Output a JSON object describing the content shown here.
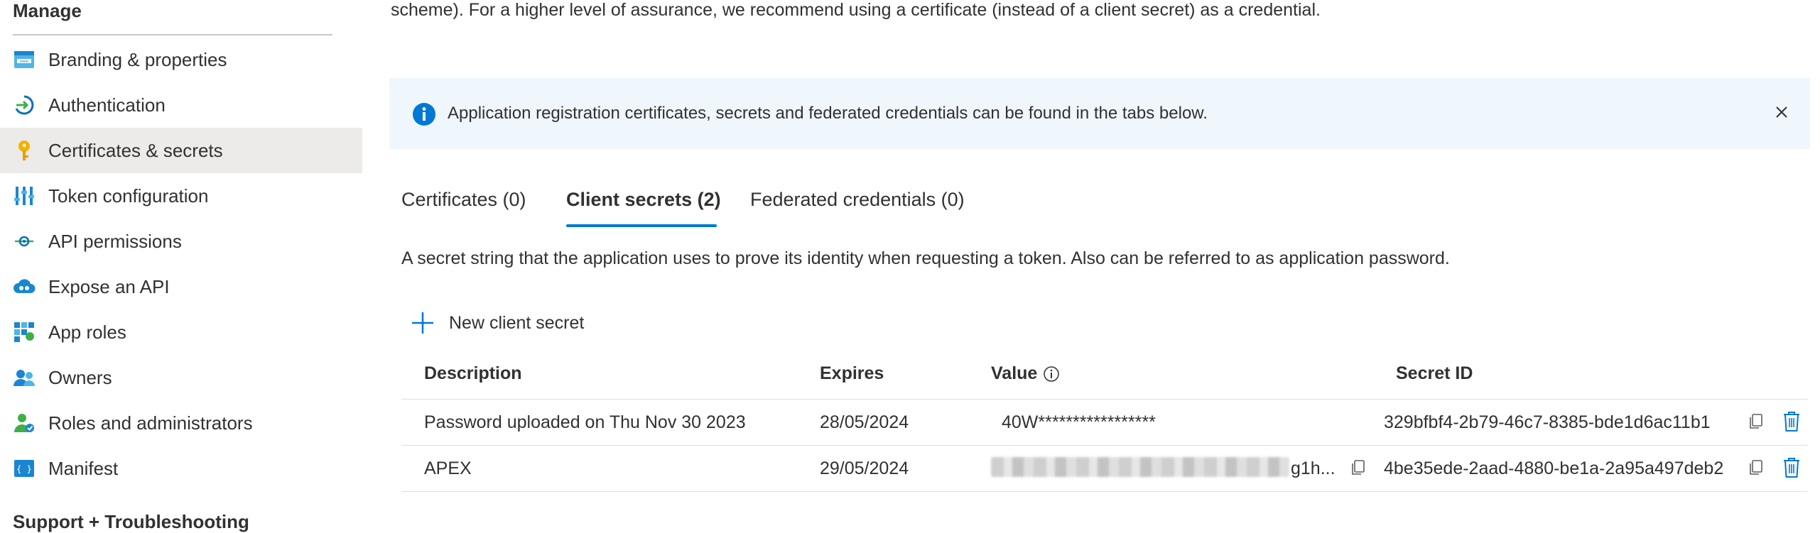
{
  "sidebar": {
    "section_title": "Manage",
    "items": [
      {
        "label": "Branding & properties",
        "icon": "branding-icon"
      },
      {
        "label": "Authentication",
        "icon": "authentication-icon"
      },
      {
        "label": "Certificates & secrets",
        "icon": "key-icon",
        "active": true
      },
      {
        "label": "Token configuration",
        "icon": "token-config-icon"
      },
      {
        "label": "API permissions",
        "icon": "api-permissions-icon"
      },
      {
        "label": "Expose an API",
        "icon": "cloud-icon"
      },
      {
        "label": "App roles",
        "icon": "app-roles-icon"
      },
      {
        "label": "Owners",
        "icon": "owners-icon"
      },
      {
        "label": "Roles and administrators",
        "icon": "roles-admin-icon"
      },
      {
        "label": "Manifest",
        "icon": "manifest-icon"
      }
    ],
    "support_title": "Support + Troubleshooting"
  },
  "main": {
    "intro": "scheme). For a higher level of assurance, we recommend using a certificate (instead of a client secret) as a credential.",
    "info_bar": {
      "text": "Application registration certificates, secrets and federated credentials can be found in the tabs below."
    },
    "tabs": [
      {
        "label": "Certificates (0)"
      },
      {
        "label": "Client secrets (2)",
        "active": true
      },
      {
        "label": "Federated credentials (0)"
      }
    ],
    "description": "A secret string that the application uses to prove its identity when requesting a token. Also can be referred to as application password.",
    "new_secret_label": "New client secret",
    "table": {
      "headers": {
        "description": "Description",
        "expires": "Expires",
        "value": "Value",
        "secret_id": "Secret ID"
      },
      "rows": [
        {
          "description": "Password uploaded on Thu Nov 30 2023",
          "expires": "28/05/2024",
          "value": "40W*****************",
          "secret_id": "329bfbf4-2b79-46c7-8385-bde1d6ac11b1"
        },
        {
          "description": "APEX",
          "expires": "29/05/2024",
          "value": "g1h...",
          "secret_id": "4be35ede-2aad-4880-be1a-2a95a497deb2"
        }
      ]
    }
  },
  "colors": {
    "accent": "#0078d4",
    "info_bg": "#eff6fc",
    "active_nav_bg": "#edebe9"
  }
}
